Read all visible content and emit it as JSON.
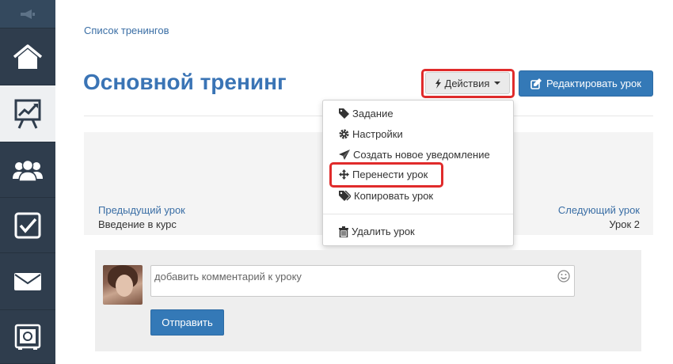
{
  "breadcrumb": {
    "label": "Список тренингов"
  },
  "page": {
    "title": "Основной тренинг"
  },
  "toolbar": {
    "actions_label": "Действия",
    "edit_label": "Редактировать урок"
  },
  "dropdown": {
    "items": [
      {
        "label": "Задание",
        "icon": "tag-icon"
      },
      {
        "label": "Настройки",
        "icon": "gear-icon"
      },
      {
        "label": "Создать новое уведомление",
        "icon": "paper-plane-icon"
      },
      {
        "label": "Перенести урок",
        "icon": "move-icon"
      },
      {
        "label": "Копировать урок",
        "icon": "tags-icon"
      },
      {
        "label": "Удалить урок",
        "icon": "trash-icon"
      }
    ]
  },
  "nav": {
    "prev_label": "Предыдущий урок",
    "prev_title": "Введение в курс",
    "next_label": "Следующий урок",
    "next_title": "Урок 2"
  },
  "comment": {
    "placeholder": "добавить комментарий к уроку",
    "send_label": "Отправить"
  },
  "sidebar": {
    "items": [
      {
        "icon": "megaphone-icon"
      },
      {
        "icon": "home-icon"
      },
      {
        "icon": "presentation-chart-icon"
      },
      {
        "icon": "users-icon"
      },
      {
        "icon": "checkbox-icon"
      },
      {
        "icon": "envelope-icon"
      },
      {
        "icon": "safe-icon"
      }
    ]
  },
  "colors": {
    "sidebar_bg": "#2f3d4d",
    "accent": "#3479b7",
    "highlight": "#e02b2b"
  }
}
